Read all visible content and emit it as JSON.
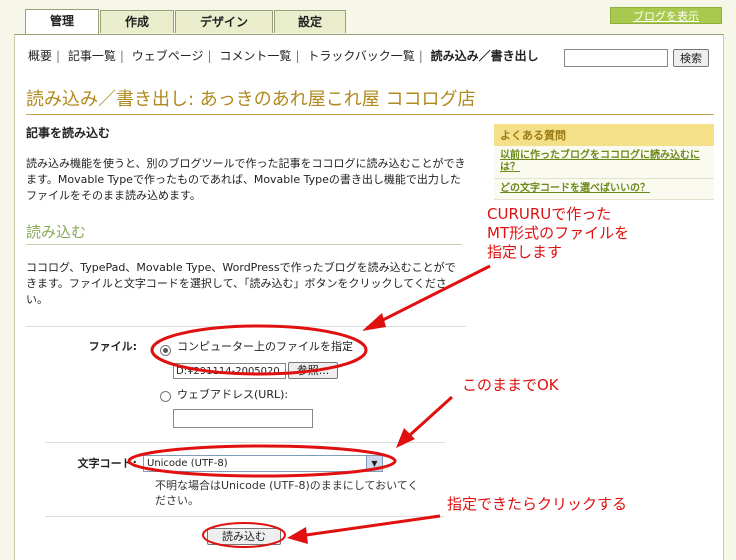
{
  "tabs": [
    "管理",
    "作成",
    "デザイン",
    "設定"
  ],
  "show_blog": "ブログを表示",
  "subnav": [
    "概要",
    "記事一覧",
    "ウェブページ",
    "コメント一覧",
    "トラックバック一覧",
    "読み込み／書き出し"
  ],
  "search_button": "検索",
  "page_title": "読み込み／書き出し: あっきのあれ屋これ屋 ココログ店",
  "section_heading": "記事を読み込む",
  "description": "読み込み機能を使うと、別のブログツールで作った記事をココログに読み込むことができます。Movable Typeで作ったものであれば、Movable Typeの書き出し機能で出力したファイルをそのまま読み込めます。",
  "import_heading": "読み込む",
  "import_description": "ココログ、TypePad、Movable Type、WordPressで作ったブログを読み込むことができます。ファイルと文字コードを選択して、「読み込む」ボタンをクリックしてください。",
  "file_label": "ファイル:",
  "radio_computer": "コンピューター上のファイルを指定",
  "file_path": "D:¥291114-2005020",
  "browse_button": "参照...",
  "radio_url": "ウェブアドレス(URL):",
  "charset_label": "文字コード:",
  "charset_value": "Unicode (UTF-8)",
  "charset_help": "不明な場合はUnicode (UTF-8)のままにしておいてください。",
  "import_button": "読み込む",
  "faq": {
    "heading": "よくある質問",
    "items": [
      "以前に作ったブログをココログに読み込むには？",
      "どの文字コードを選べばいいの？"
    ]
  },
  "annotations": {
    "a1": [
      "CURURUで作った",
      "MT形式のファイルを",
      "指定します"
    ],
    "a2": "このままでOK",
    "a3": "指定できたらクリックする"
  },
  "colors": {
    "annotation": "#e01010",
    "title": "#b08a1e",
    "accent_green": "#a8c84e"
  }
}
